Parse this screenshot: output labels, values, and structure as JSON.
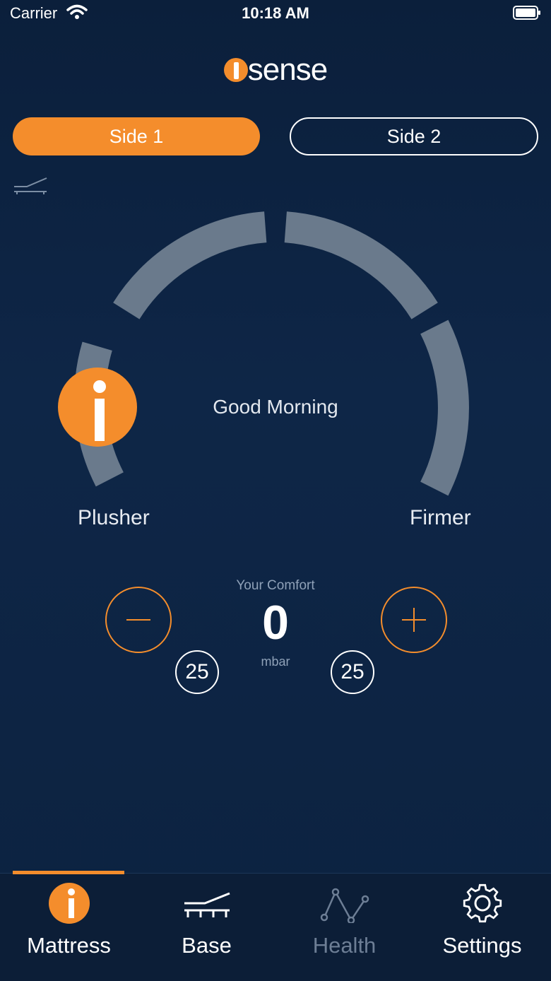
{
  "status_bar": {
    "carrier": "Carrier",
    "time": "10:18 AM"
  },
  "logo": {
    "text": "sense"
  },
  "sides": {
    "side1": "Side 1",
    "side2": "Side 2",
    "selected": "side1"
  },
  "dial": {
    "greeting": "Good Morning",
    "left_label": "Plusher",
    "right_label": "Firmer"
  },
  "comfort": {
    "label": "Your Comfort",
    "value": "0",
    "unit": "mbar",
    "step_left": "25",
    "step_right": "25"
  },
  "tabs": [
    {
      "label": "Mattress",
      "icon": "info-icon",
      "active": true
    },
    {
      "label": "Base",
      "icon": "bed-base-icon",
      "active": false
    },
    {
      "label": "Health",
      "icon": "health-graph-icon",
      "active": false,
      "disabled": true
    },
    {
      "label": "Settings",
      "icon": "gear-icon",
      "active": false
    }
  ],
  "colors": {
    "accent": "#f48d2c",
    "background": "#0e2647",
    "dial_segment": "#6a7a8c"
  }
}
